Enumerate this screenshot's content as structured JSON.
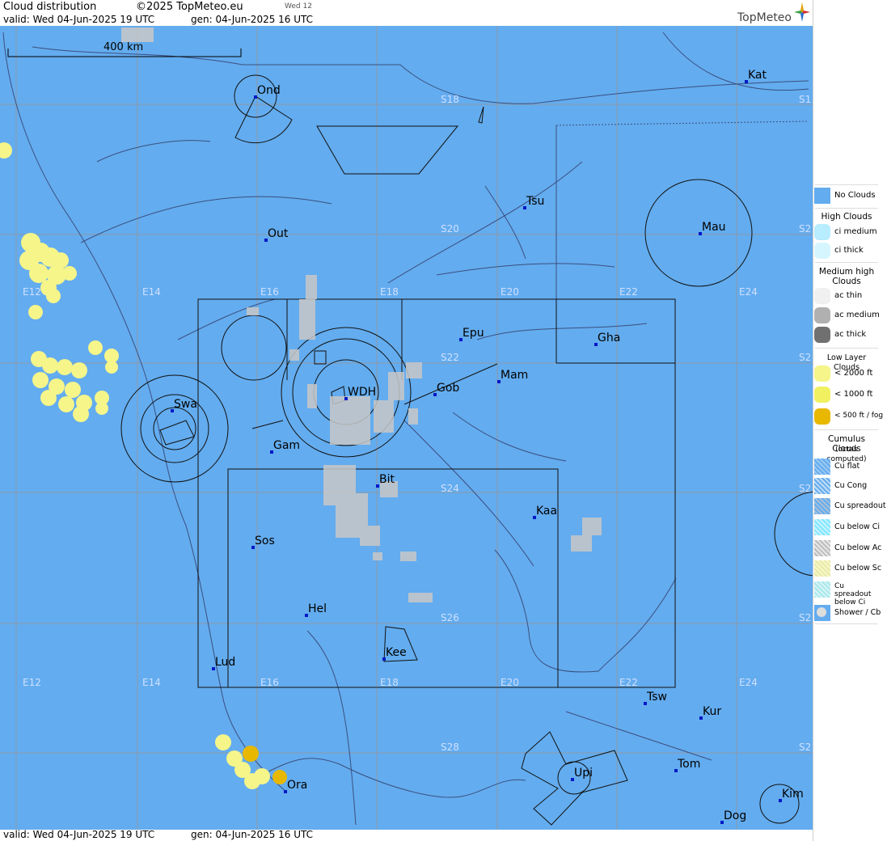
{
  "header": {
    "title": "Cloud distribution",
    "copyright": "©2025 TopMeteo.eu",
    "day_tab": "Wed 12",
    "valid": "valid:  Wed  04-Jun-2025  19 UTC",
    "gen": "gen: 04-Jun-2025 16 UTC",
    "logo": "TopMeteo"
  },
  "footer": {
    "valid": "valid:  Wed  04-Jun-2025  19 UTC",
    "gen": "gen: 04-Jun-2025 16 UTC"
  },
  "map": {
    "scale_label": "400 km",
    "colors": {
      "sea_background": "#63acef",
      "grid": "#8c9aa8",
      "cloud_low_2000": "#f5f58a",
      "cloud_low_1000": "#f0f060",
      "cloud_fog": "#e8b800",
      "cumulus_dots": "#c8c8c8"
    },
    "longitudes": [
      {
        "label": "E12"
      },
      {
        "label": "E14"
      },
      {
        "label": "E16"
      },
      {
        "label": "E18"
      },
      {
        "label": "E20"
      },
      {
        "label": "E22"
      },
      {
        "label": "E24"
      }
    ],
    "latitudes": [
      {
        "label": "S18"
      },
      {
        "label": "S20"
      },
      {
        "label": "S22"
      },
      {
        "label": "S24"
      },
      {
        "label": "S26"
      },
      {
        "label": "S28"
      }
    ],
    "right_edge_labels": [
      "S1",
      "S2",
      "S2",
      "S2",
      "S2",
      "S2"
    ],
    "places": [
      {
        "name": "Ond"
      },
      {
        "name": "Kat"
      },
      {
        "name": "Tsu"
      },
      {
        "name": "Out"
      },
      {
        "name": "Mau"
      },
      {
        "name": "Epu"
      },
      {
        "name": "Gha"
      },
      {
        "name": "Mam"
      },
      {
        "name": "Gob"
      },
      {
        "name": "WDH"
      },
      {
        "name": "Swa"
      },
      {
        "name": "Gam"
      },
      {
        "name": "Bit"
      },
      {
        "name": "Kaa"
      },
      {
        "name": "Sos"
      },
      {
        "name": "Hel"
      },
      {
        "name": "Kee"
      },
      {
        "name": "Lud"
      },
      {
        "name": "Tsw"
      },
      {
        "name": "Kur"
      },
      {
        "name": "Tom"
      },
      {
        "name": "Upi"
      },
      {
        "name": "Ora"
      },
      {
        "name": "Kim"
      },
      {
        "name": "Dog"
      }
    ]
  },
  "legend": {
    "no_clouds": "No Clouds",
    "high_title": "High Clouds",
    "high": [
      "ci medium",
      "ci thick"
    ],
    "medium_title": "Medium high Clouds",
    "medium": [
      "ac thin",
      "ac medium",
      "ac thick"
    ],
    "low_title": "Low Layer Clouds",
    "low": [
      "< 2000 ft",
      "< 1000 ft",
      "< 500 ft / fog"
    ],
    "cumulus_title": "Cumulus Clouds",
    "cumulus_sub": "(octas computed)",
    "cumulus": [
      "Cu flat",
      "Cu Cong",
      "Cu spreadout",
      "Cu below Ci",
      "Cu below Ac",
      "Cu below Sc",
      "Cu spreadout below Ci",
      "Shower / Cb"
    ],
    "colors": {
      "no_clouds": "#63acef",
      "ci_medium": "#b8ecff",
      "ci_thick": "#d6f6ff",
      "ac_thin": "#f0f0f0",
      "ac_medium": "#b0b0b0",
      "ac_thick": "#707070",
      "low_2000": "#f5f58a",
      "low_1000": "#f0f060",
      "low_500": "#e8b800"
    }
  }
}
